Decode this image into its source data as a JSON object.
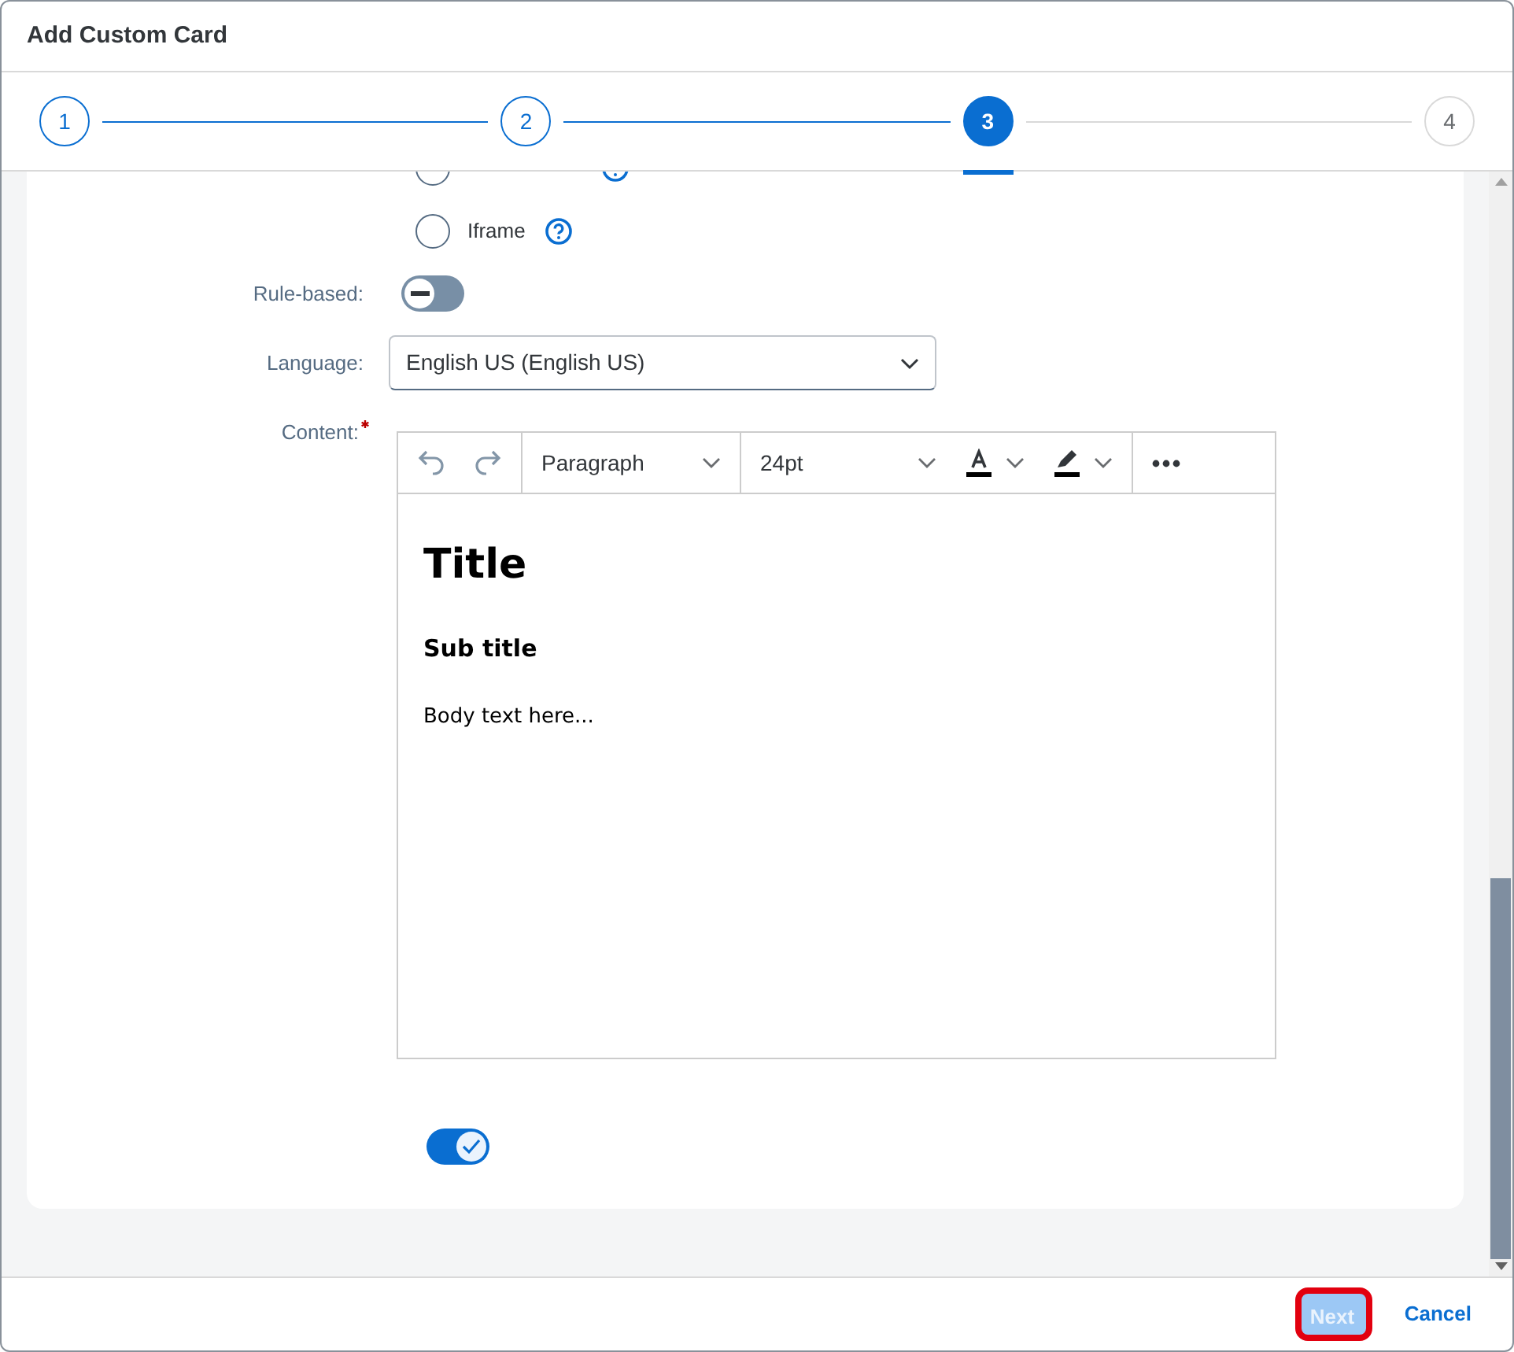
{
  "dialog": {
    "title": "Add Custom Card"
  },
  "steps": [
    {
      "label": "1",
      "completed": true,
      "selected": false
    },
    {
      "label": "2",
      "completed": true,
      "selected": false
    },
    {
      "label": "3",
      "completed": false,
      "selected": true
    },
    {
      "label": "4",
      "completed": false,
      "selected": false
    }
  ],
  "form": {
    "radio_options": [
      {
        "selected": false
      },
      {
        "label": "Iframe",
        "selected": false
      }
    ],
    "rule_based": {
      "label": "Rule-based:",
      "on": false
    },
    "language": {
      "label": "Language:",
      "value": "English US (English US)"
    },
    "content": {
      "label": "Content:",
      "required": true,
      "toolbar": {
        "block_format": "Paragraph",
        "font_size": "24pt"
      },
      "body": [
        {
          "kind": "heading",
          "text": "Title"
        },
        {
          "kind": "subheading",
          "text": "Sub title"
        },
        {
          "kind": "paragraph",
          "text": "Body text here..."
        }
      ]
    },
    "bottom_toggle": {
      "on": true
    }
  },
  "footer": {
    "buttons": [
      {
        "label": "Next",
        "kind": "primary",
        "disabled": true,
        "highlighted": true
      },
      {
        "label": "Cancel",
        "kind": "link"
      }
    ]
  }
}
